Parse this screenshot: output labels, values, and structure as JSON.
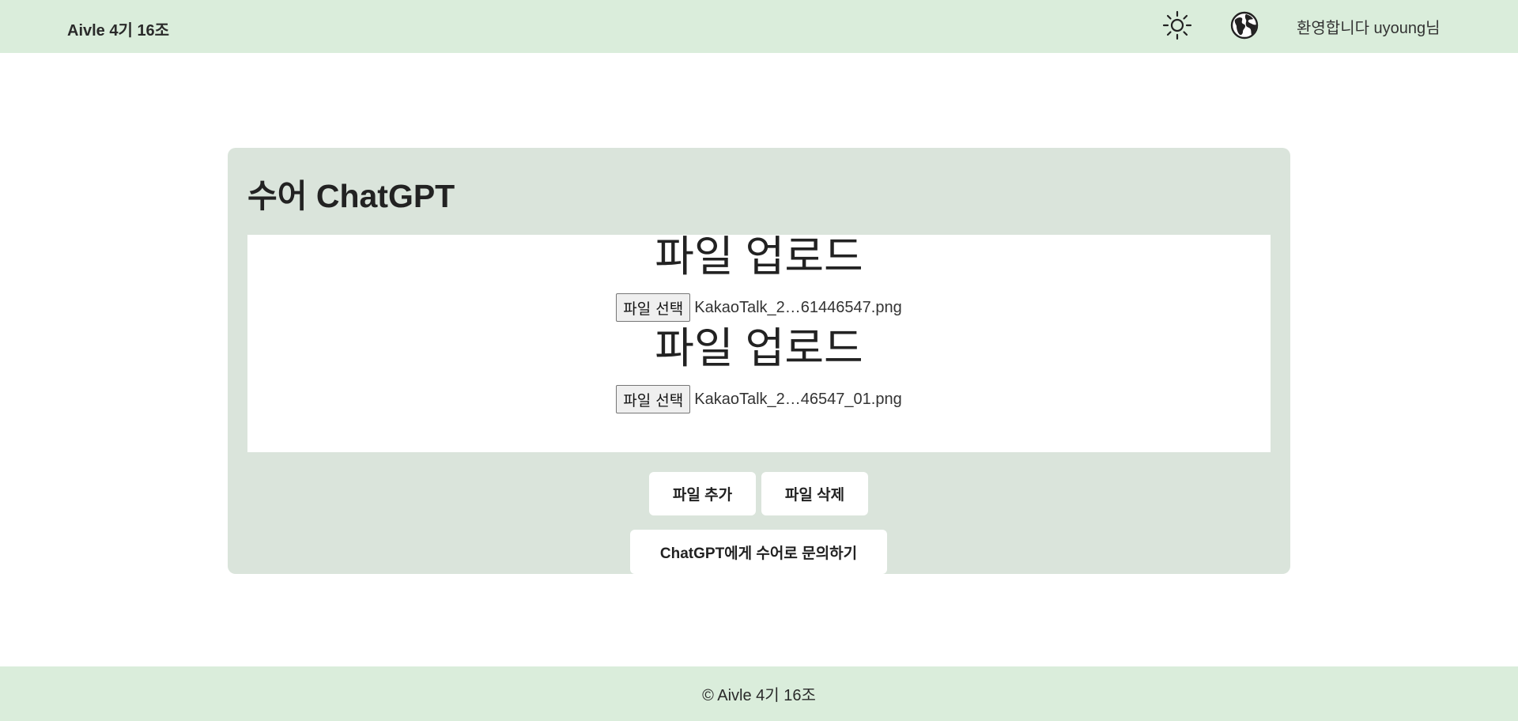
{
  "header": {
    "brand": "Aivle 4기 16조",
    "theme_icon": "sun-icon",
    "language_icon": "globe-icon",
    "welcome": "환영합니다 uyoung님",
    "background": "#daeddb"
  },
  "card": {
    "title": "수어 ChatGPT",
    "background": "#dae4db",
    "uploads": [
      {
        "title": "파일 업로드",
        "button_label": "파일 선택",
        "file_name": "KakaoTalk_2…61446547.png"
      },
      {
        "title": "파일 업로드",
        "button_label": "파일 선택",
        "file_name": "KakaoTalk_2…46547_01.png"
      }
    ],
    "add_label": "파일 추가",
    "delete_label": "파일 삭제",
    "ask_label": "ChatGPT에게 수어로 문의하기"
  },
  "footer": {
    "text": "© Aivle 4기 16조"
  }
}
